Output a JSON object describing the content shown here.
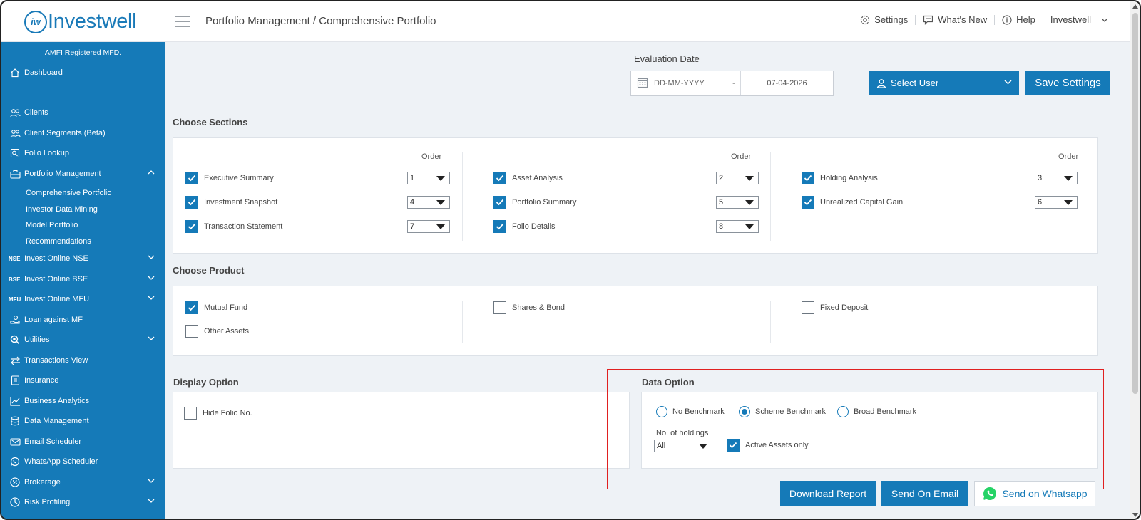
{
  "header": {
    "logo_text": "Investwell",
    "logo_mark": "iw",
    "breadcrumb": "Portfolio Management / Comprehensive Portfolio",
    "settings_label": "Settings",
    "whats_new_label": "What's New",
    "help_label": "Help",
    "user_label": "Investwell"
  },
  "sidebar": {
    "amfi": "AMFI Registered MFD.",
    "items": [
      {
        "label": "Dashboard",
        "icon": "home-icon"
      },
      {
        "label": "Clients",
        "icon": "users-icon"
      },
      {
        "label": "Client Segments (Beta)",
        "icon": "users-icon"
      },
      {
        "label": "Folio Lookup",
        "icon": "folio-icon"
      },
      {
        "label": "Portfolio Management",
        "icon": "briefcase-icon"
      },
      {
        "label": "Invest Online NSE",
        "tag": "NSE"
      },
      {
        "label": "Invest Online BSE",
        "tag": "BSE"
      },
      {
        "label": "Invest Online MFU",
        "tag": "MFU"
      },
      {
        "label": "Loan against MF",
        "icon": "loan-icon"
      },
      {
        "label": "Utilities",
        "icon": "utilities-icon"
      },
      {
        "label": "Transactions View",
        "icon": "arrows-icon"
      },
      {
        "label": "Insurance",
        "icon": "insurance-icon"
      },
      {
        "label": "Business Analytics",
        "icon": "chart-icon"
      },
      {
        "label": "Data Management",
        "icon": "database-icon"
      },
      {
        "label": "Email Scheduler",
        "icon": "email-icon"
      },
      {
        "label": "WhatsApp Scheduler",
        "icon": "whatsapp-icon"
      },
      {
        "label": "Brokerage",
        "icon": "percent-icon"
      },
      {
        "label": "Risk Profiling",
        "icon": "risk-icon"
      }
    ],
    "sub_items": [
      "Comprehensive Portfolio",
      "Investor Data Mining",
      "Model Portfolio",
      "Recommendations"
    ]
  },
  "evaluation": {
    "label": "Evaluation Date",
    "from_placeholder": "DD-MM-YYYY",
    "separator": "-",
    "to_date": "07-04-2026"
  },
  "select_user_label": "Select User",
  "save_settings_label": "Save Settings",
  "sections": {
    "title": "Choose Sections",
    "order_label": "Order",
    "items": [
      {
        "label": "Executive Summary",
        "checked": true,
        "order": "1"
      },
      {
        "label": "Asset Analysis",
        "checked": true,
        "order": "2"
      },
      {
        "label": "Holding Analysis",
        "checked": true,
        "order": "3"
      },
      {
        "label": "Investment Snapshot",
        "checked": true,
        "order": "4"
      },
      {
        "label": "Portfolio Summary",
        "checked": true,
        "order": "5"
      },
      {
        "label": "Unrealized Capital Gain",
        "checked": true,
        "order": "6"
      },
      {
        "label": "Transaction Statement",
        "checked": true,
        "order": "7"
      },
      {
        "label": "Folio Details",
        "checked": true,
        "order": "8"
      }
    ]
  },
  "products": {
    "title": "Choose Product",
    "items": [
      {
        "label": "Mutual Fund",
        "checked": true
      },
      {
        "label": "Shares & Bond",
        "checked": false
      },
      {
        "label": "Fixed Deposit",
        "checked": false
      },
      {
        "label": "Other Assets",
        "checked": false
      }
    ]
  },
  "display_option": {
    "title": "Display Option",
    "hide_folio_label": "Hide Folio No.",
    "hide_folio_checked": false
  },
  "data_option": {
    "title": "Data Option",
    "benchmarks": [
      {
        "label": "No Benchmark",
        "selected": false
      },
      {
        "label": "Scheme Benchmark",
        "selected": true
      },
      {
        "label": "Broad Benchmark",
        "selected": false
      }
    ],
    "holdings_label": "No. of holdings",
    "holdings_value": "All",
    "active_assets_label": "Active Assets only",
    "active_assets_checked": true
  },
  "actions": {
    "download_label": "Download Report",
    "email_label": "Send On Email",
    "whatsapp_label": "Send on Whatsapp"
  },
  "colors": {
    "brand": "#157ab8",
    "highlight": "#e02020",
    "whatsapp": "#25d366"
  }
}
